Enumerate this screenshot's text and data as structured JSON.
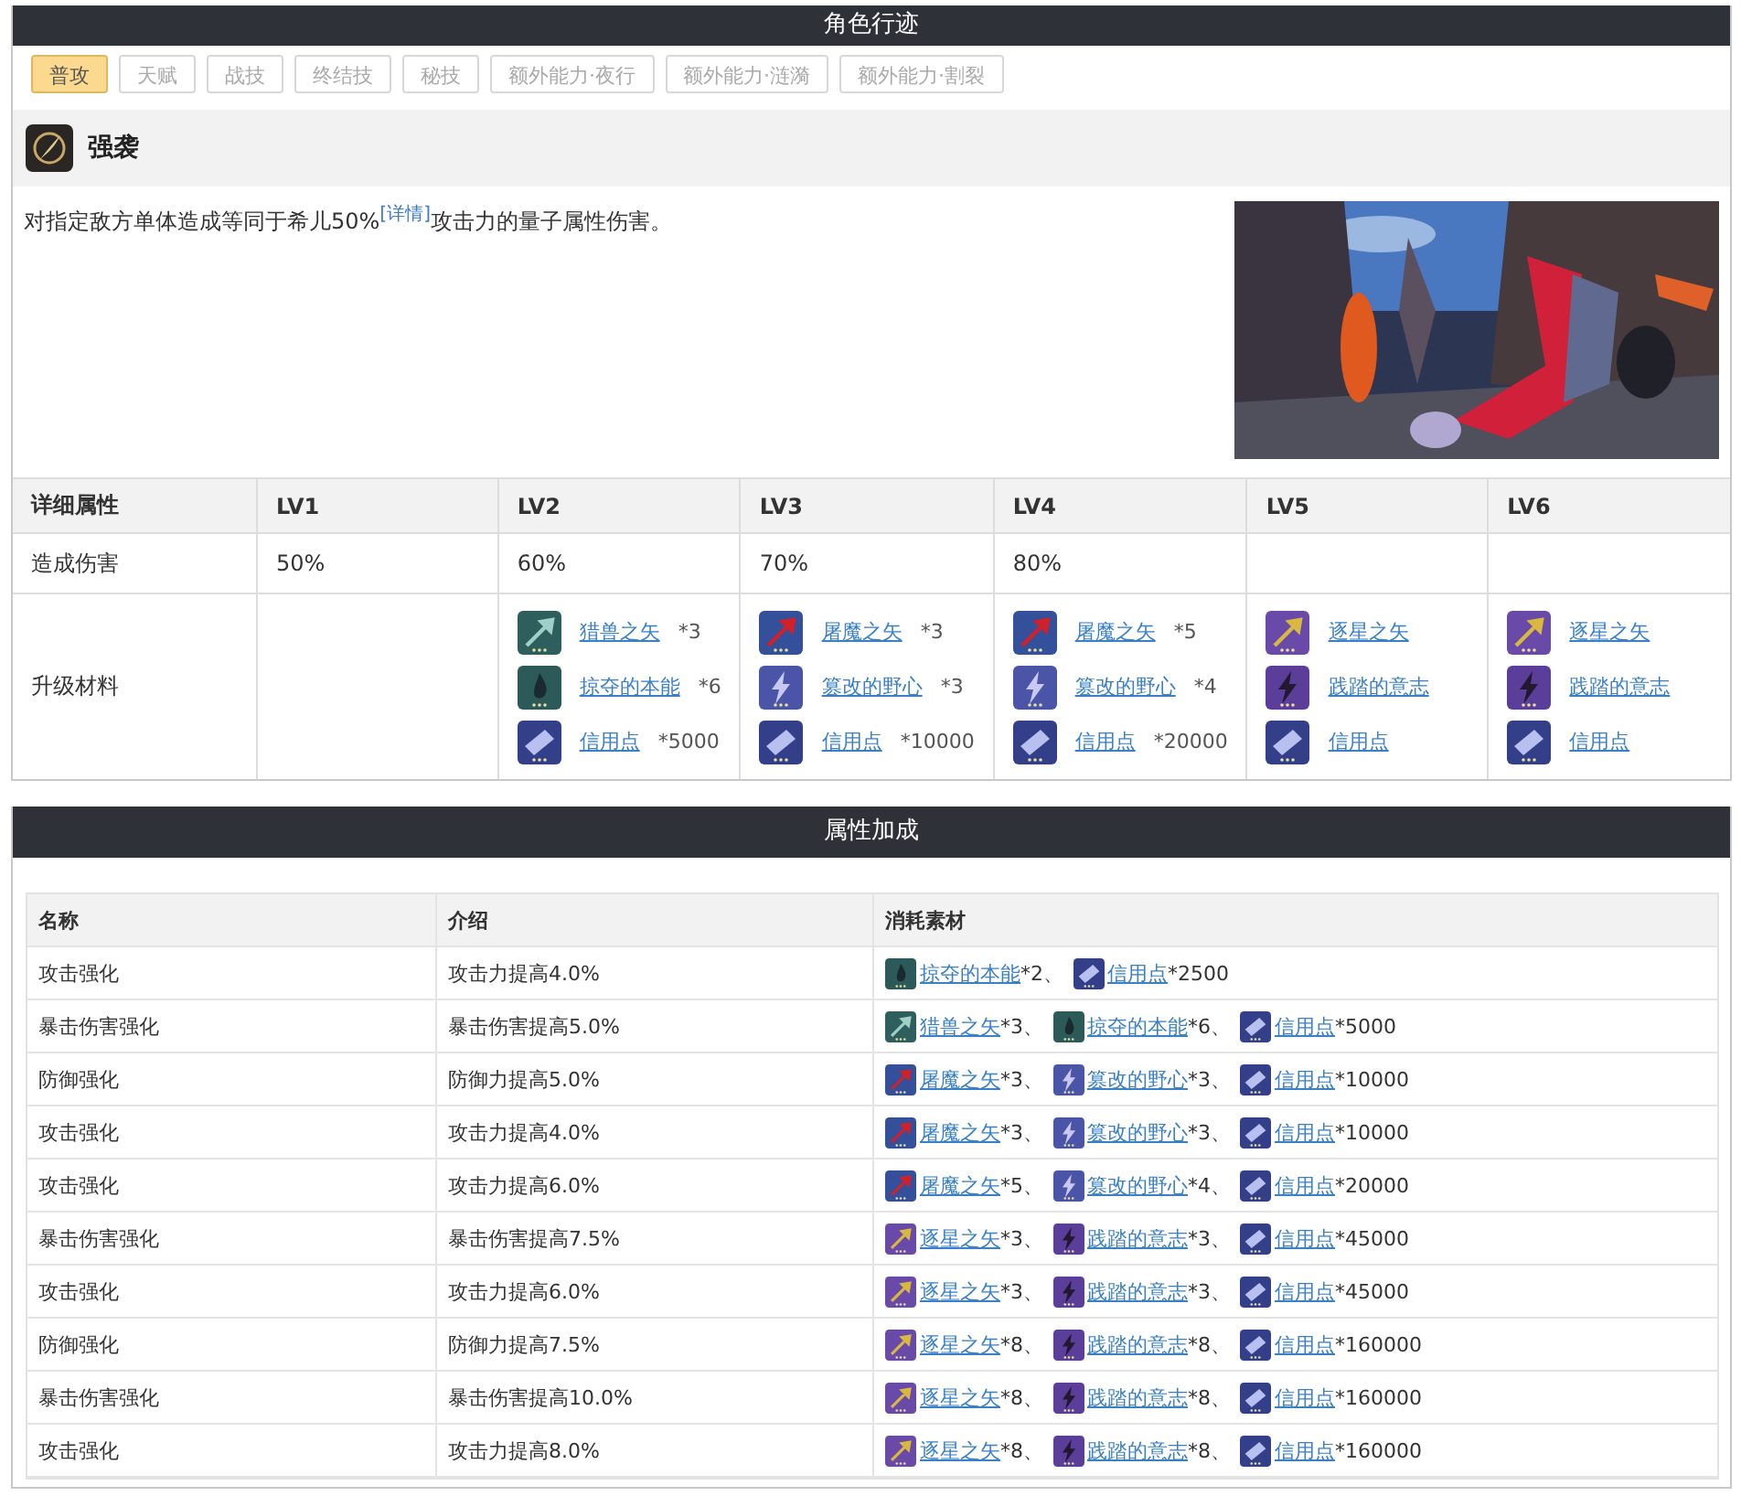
{
  "section_title": "角色行迹",
  "tabs": [
    {
      "label": "普攻",
      "selected": true
    },
    {
      "label": "天赋",
      "selected": false
    },
    {
      "label": "战技",
      "selected": false
    },
    {
      "label": "终结技",
      "selected": false
    },
    {
      "label": "秘技",
      "selected": false
    },
    {
      "label": "额外能力·夜行",
      "selected": false
    },
    {
      "label": "额外能力·涟漪",
      "selected": false
    },
    {
      "label": "额外能力·割裂",
      "selected": false
    }
  ],
  "skill": {
    "name": "强袭",
    "description_before": "对指定敌方单体造成等同于希儿50%",
    "detail_link": "[详情]",
    "description_after": "攻击力的量子属性伤害。"
  },
  "level_table": {
    "header": "详细属性",
    "damage_label": "造成伤害",
    "materials_label": "升级材料",
    "levels": [
      {
        "label": "LV1",
        "damage": "50%"
      },
      {
        "label": "LV2",
        "damage": "60%",
        "materials": [
          {
            "name": "猎兽之矢",
            "count": "*3",
            "kind": "hunt"
          },
          {
            "name": "掠夺的本能",
            "count": "*6",
            "kind": "plunder"
          },
          {
            "name": "信用点",
            "count": "*5000",
            "kind": "credit"
          }
        ]
      },
      {
        "label": "LV3",
        "damage": "70%",
        "materials": [
          {
            "name": "屠魔之矢",
            "count": "*3",
            "kind": "demon"
          },
          {
            "name": "篡改的野心",
            "count": "*3",
            "kind": "ambition"
          },
          {
            "name": "信用点",
            "count": "*10000",
            "kind": "credit"
          }
        ]
      },
      {
        "label": "LV4",
        "damage": "80%",
        "materials": [
          {
            "name": "屠魔之矢",
            "count": "*5",
            "kind": "demon"
          },
          {
            "name": "篡改的野心",
            "count": "*4",
            "kind": "ambition"
          },
          {
            "name": "信用点",
            "count": "*20000",
            "kind": "credit"
          }
        ]
      },
      {
        "label": "LV5",
        "materials": [
          {
            "name": "逐星之矢",
            "kind": "star"
          },
          {
            "name": "践踏的意志",
            "kind": "will"
          },
          {
            "name": "信用点",
            "kind": "credit"
          }
        ]
      },
      {
        "label": "LV6",
        "materials": [
          {
            "name": "逐星之矢",
            "kind": "star"
          },
          {
            "name": "践踏的意志",
            "kind": "will"
          },
          {
            "name": "信用点",
            "kind": "credit"
          }
        ]
      }
    ]
  },
  "bonus_title": "属性加成",
  "bonus_table": {
    "columns": [
      "名称",
      "介绍",
      "消耗素材"
    ],
    "rows": [
      {
        "name": "攻击强化",
        "effect": "攻击力提高4.0%",
        "materials": [
          {
            "name": "掠夺的本能",
            "count": "*2、",
            "kind": "plunder"
          },
          {
            "name": "信用点",
            "count": "*2500",
            "kind": "credit"
          }
        ]
      },
      {
        "name": "暴击伤害强化",
        "effect": "暴击伤害提高5.0%",
        "materials": [
          {
            "name": "猎兽之矢",
            "count": "*3、",
            "kind": "hunt"
          },
          {
            "name": "掠夺的本能",
            "count": "*6、",
            "kind": "plunder"
          },
          {
            "name": "信用点",
            "count": "*5000",
            "kind": "credit"
          }
        ]
      },
      {
        "name": "防御强化",
        "effect": "防御力提高5.0%",
        "materials": [
          {
            "name": "屠魔之矢",
            "count": "*3、",
            "kind": "demon"
          },
          {
            "name": "篡改的野心",
            "count": "*3、",
            "kind": "ambition"
          },
          {
            "name": "信用点",
            "count": "*10000",
            "kind": "credit"
          }
        ]
      },
      {
        "name": "攻击强化",
        "effect": "攻击力提高4.0%",
        "materials": [
          {
            "name": "屠魔之矢",
            "count": "*3、",
            "kind": "demon"
          },
          {
            "name": "篡改的野心",
            "count": "*3、",
            "kind": "ambition"
          },
          {
            "name": "信用点",
            "count": "*10000",
            "kind": "credit"
          }
        ]
      },
      {
        "name": "攻击强化",
        "effect": "攻击力提高6.0%",
        "materials": [
          {
            "name": "屠魔之矢",
            "count": "*5、",
            "kind": "demon"
          },
          {
            "name": "篡改的野心",
            "count": "*4、",
            "kind": "ambition"
          },
          {
            "name": "信用点",
            "count": "*20000",
            "kind": "credit"
          }
        ]
      },
      {
        "name": "暴击伤害强化",
        "effect": "暴击伤害提高7.5%",
        "materials": [
          {
            "name": "逐星之矢",
            "count": "*3、",
            "kind": "star"
          },
          {
            "name": "践踏的意志",
            "count": "*3、",
            "kind": "will"
          },
          {
            "name": "信用点",
            "count": "*45000",
            "kind": "credit"
          }
        ]
      },
      {
        "name": "攻击强化",
        "effect": "攻击力提高6.0%",
        "materials": [
          {
            "name": "逐星之矢",
            "count": "*3、",
            "kind": "star"
          },
          {
            "name": "践踏的意志",
            "count": "*3、",
            "kind": "will"
          },
          {
            "name": "信用点",
            "count": "*45000",
            "kind": "credit"
          }
        ]
      },
      {
        "name": "防御强化",
        "effect": "防御力提高7.5%",
        "materials": [
          {
            "name": "逐星之矢",
            "count": "*8、",
            "kind": "star"
          },
          {
            "name": "践踏的意志",
            "count": "*8、",
            "kind": "will"
          },
          {
            "name": "信用点",
            "count": "*160000",
            "kind": "credit"
          }
        ]
      },
      {
        "name": "暴击伤害强化",
        "effect": "暴击伤害提高10.0%",
        "materials": [
          {
            "name": "逐星之矢",
            "count": "*8、",
            "kind": "star"
          },
          {
            "name": "践踏的意志",
            "count": "*8、",
            "kind": "will"
          },
          {
            "name": "信用点",
            "count": "*160000",
            "kind": "credit"
          }
        ]
      },
      {
        "name": "攻击强化",
        "effect": "攻击力提高8.0%",
        "materials": [
          {
            "name": "逐星之矢",
            "count": "*8、",
            "kind": "star"
          },
          {
            "name": "践踏的意志",
            "count": "*8、",
            "kind": "will"
          },
          {
            "name": "信用点",
            "count": "*160000",
            "kind": "credit"
          }
        ]
      }
    ]
  }
}
